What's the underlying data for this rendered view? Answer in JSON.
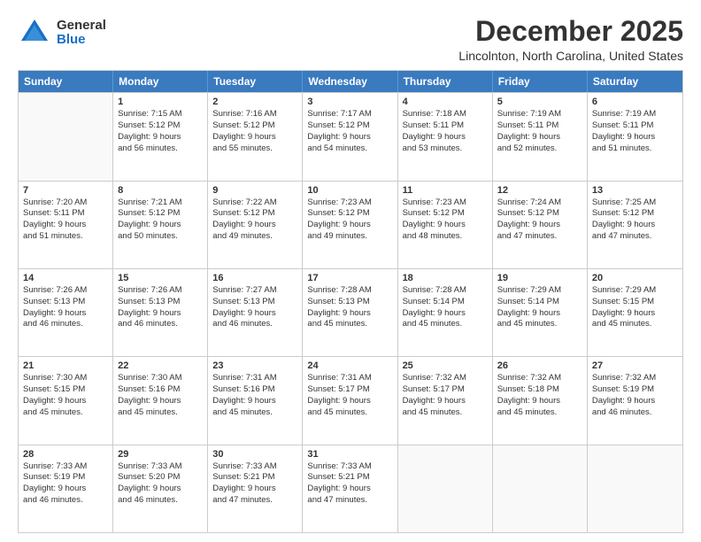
{
  "logo": {
    "general": "General",
    "blue": "Blue"
  },
  "header": {
    "month": "December 2025",
    "location": "Lincolnton, North Carolina, United States"
  },
  "weekdays": [
    "Sunday",
    "Monday",
    "Tuesday",
    "Wednesday",
    "Thursday",
    "Friday",
    "Saturday"
  ],
  "rows": [
    [
      {
        "day": "",
        "lines": [],
        "empty": true
      },
      {
        "day": "1",
        "lines": [
          "Sunrise: 7:15 AM",
          "Sunset: 5:12 PM",
          "Daylight: 9 hours",
          "and 56 minutes."
        ]
      },
      {
        "day": "2",
        "lines": [
          "Sunrise: 7:16 AM",
          "Sunset: 5:12 PM",
          "Daylight: 9 hours",
          "and 55 minutes."
        ]
      },
      {
        "day": "3",
        "lines": [
          "Sunrise: 7:17 AM",
          "Sunset: 5:12 PM",
          "Daylight: 9 hours",
          "and 54 minutes."
        ]
      },
      {
        "day": "4",
        "lines": [
          "Sunrise: 7:18 AM",
          "Sunset: 5:11 PM",
          "Daylight: 9 hours",
          "and 53 minutes."
        ]
      },
      {
        "day": "5",
        "lines": [
          "Sunrise: 7:19 AM",
          "Sunset: 5:11 PM",
          "Daylight: 9 hours",
          "and 52 minutes."
        ]
      },
      {
        "day": "6",
        "lines": [
          "Sunrise: 7:19 AM",
          "Sunset: 5:11 PM",
          "Daylight: 9 hours",
          "and 51 minutes."
        ]
      }
    ],
    [
      {
        "day": "7",
        "lines": [
          "Sunrise: 7:20 AM",
          "Sunset: 5:11 PM",
          "Daylight: 9 hours",
          "and 51 minutes."
        ]
      },
      {
        "day": "8",
        "lines": [
          "Sunrise: 7:21 AM",
          "Sunset: 5:12 PM",
          "Daylight: 9 hours",
          "and 50 minutes."
        ]
      },
      {
        "day": "9",
        "lines": [
          "Sunrise: 7:22 AM",
          "Sunset: 5:12 PM",
          "Daylight: 9 hours",
          "and 49 minutes."
        ]
      },
      {
        "day": "10",
        "lines": [
          "Sunrise: 7:23 AM",
          "Sunset: 5:12 PM",
          "Daylight: 9 hours",
          "and 49 minutes."
        ]
      },
      {
        "day": "11",
        "lines": [
          "Sunrise: 7:23 AM",
          "Sunset: 5:12 PM",
          "Daylight: 9 hours",
          "and 48 minutes."
        ]
      },
      {
        "day": "12",
        "lines": [
          "Sunrise: 7:24 AM",
          "Sunset: 5:12 PM",
          "Daylight: 9 hours",
          "and 47 minutes."
        ]
      },
      {
        "day": "13",
        "lines": [
          "Sunrise: 7:25 AM",
          "Sunset: 5:12 PM",
          "Daylight: 9 hours",
          "and 47 minutes."
        ]
      }
    ],
    [
      {
        "day": "14",
        "lines": [
          "Sunrise: 7:26 AM",
          "Sunset: 5:13 PM",
          "Daylight: 9 hours",
          "and 46 minutes."
        ]
      },
      {
        "day": "15",
        "lines": [
          "Sunrise: 7:26 AM",
          "Sunset: 5:13 PM",
          "Daylight: 9 hours",
          "and 46 minutes."
        ]
      },
      {
        "day": "16",
        "lines": [
          "Sunrise: 7:27 AM",
          "Sunset: 5:13 PM",
          "Daylight: 9 hours",
          "and 46 minutes."
        ]
      },
      {
        "day": "17",
        "lines": [
          "Sunrise: 7:28 AM",
          "Sunset: 5:13 PM",
          "Daylight: 9 hours",
          "and 45 minutes."
        ]
      },
      {
        "day": "18",
        "lines": [
          "Sunrise: 7:28 AM",
          "Sunset: 5:14 PM",
          "Daylight: 9 hours",
          "and 45 minutes."
        ]
      },
      {
        "day": "19",
        "lines": [
          "Sunrise: 7:29 AM",
          "Sunset: 5:14 PM",
          "Daylight: 9 hours",
          "and 45 minutes."
        ]
      },
      {
        "day": "20",
        "lines": [
          "Sunrise: 7:29 AM",
          "Sunset: 5:15 PM",
          "Daylight: 9 hours",
          "and 45 minutes."
        ]
      }
    ],
    [
      {
        "day": "21",
        "lines": [
          "Sunrise: 7:30 AM",
          "Sunset: 5:15 PM",
          "Daylight: 9 hours",
          "and 45 minutes."
        ]
      },
      {
        "day": "22",
        "lines": [
          "Sunrise: 7:30 AM",
          "Sunset: 5:16 PM",
          "Daylight: 9 hours",
          "and 45 minutes."
        ]
      },
      {
        "day": "23",
        "lines": [
          "Sunrise: 7:31 AM",
          "Sunset: 5:16 PM",
          "Daylight: 9 hours",
          "and 45 minutes."
        ]
      },
      {
        "day": "24",
        "lines": [
          "Sunrise: 7:31 AM",
          "Sunset: 5:17 PM",
          "Daylight: 9 hours",
          "and 45 minutes."
        ]
      },
      {
        "day": "25",
        "lines": [
          "Sunrise: 7:32 AM",
          "Sunset: 5:17 PM",
          "Daylight: 9 hours",
          "and 45 minutes."
        ]
      },
      {
        "day": "26",
        "lines": [
          "Sunrise: 7:32 AM",
          "Sunset: 5:18 PM",
          "Daylight: 9 hours",
          "and 45 minutes."
        ]
      },
      {
        "day": "27",
        "lines": [
          "Sunrise: 7:32 AM",
          "Sunset: 5:19 PM",
          "Daylight: 9 hours",
          "and 46 minutes."
        ]
      }
    ],
    [
      {
        "day": "28",
        "lines": [
          "Sunrise: 7:33 AM",
          "Sunset: 5:19 PM",
          "Daylight: 9 hours",
          "and 46 minutes."
        ]
      },
      {
        "day": "29",
        "lines": [
          "Sunrise: 7:33 AM",
          "Sunset: 5:20 PM",
          "Daylight: 9 hours",
          "and 46 minutes."
        ]
      },
      {
        "day": "30",
        "lines": [
          "Sunrise: 7:33 AM",
          "Sunset: 5:21 PM",
          "Daylight: 9 hours",
          "and 47 minutes."
        ]
      },
      {
        "day": "31",
        "lines": [
          "Sunrise: 7:33 AM",
          "Sunset: 5:21 PM",
          "Daylight: 9 hours",
          "and 47 minutes."
        ]
      },
      {
        "day": "",
        "lines": [],
        "empty": true
      },
      {
        "day": "",
        "lines": [],
        "empty": true
      },
      {
        "day": "",
        "lines": [],
        "empty": true
      }
    ]
  ]
}
